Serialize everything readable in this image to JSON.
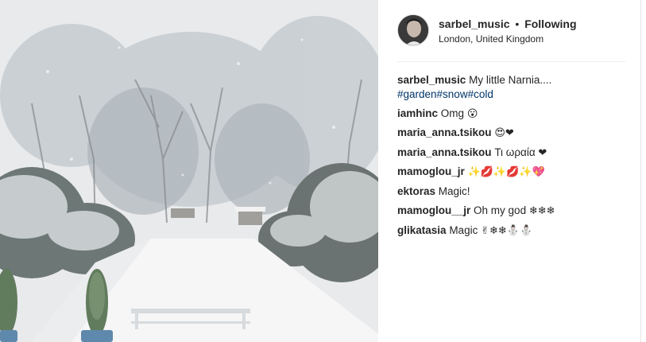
{
  "post": {
    "username": "sarbel_music",
    "separator": "•",
    "follow_status": "Following",
    "location": "London, United Kingdom",
    "caption_user": "sarbel_music",
    "caption_text": "My little Narnia....",
    "caption_tags": "#garden#snow#cold"
  },
  "comments": [
    {
      "user": "iamhinc",
      "text": "Omg",
      "emoji": "😮"
    },
    {
      "user": "maria_anna.tsikou",
      "text": "",
      "emoji": "😍❤"
    },
    {
      "user": "maria_anna.tsikou",
      "text": "Τι ωραία",
      "emoji": "❤"
    },
    {
      "user": "mamoglou_jr",
      "text": "",
      "emoji": "✨💋✨💋✨💖"
    },
    {
      "user": "ektoras",
      "text": "Magic!",
      "emoji": ""
    },
    {
      "user": "mamoglou__jr",
      "text": "Oh my god",
      "emoji": "❄❄❄"
    },
    {
      "user": "glikatasia",
      "text": "Magic",
      "emoji": "✌❄❄⛄⛄"
    }
  ]
}
